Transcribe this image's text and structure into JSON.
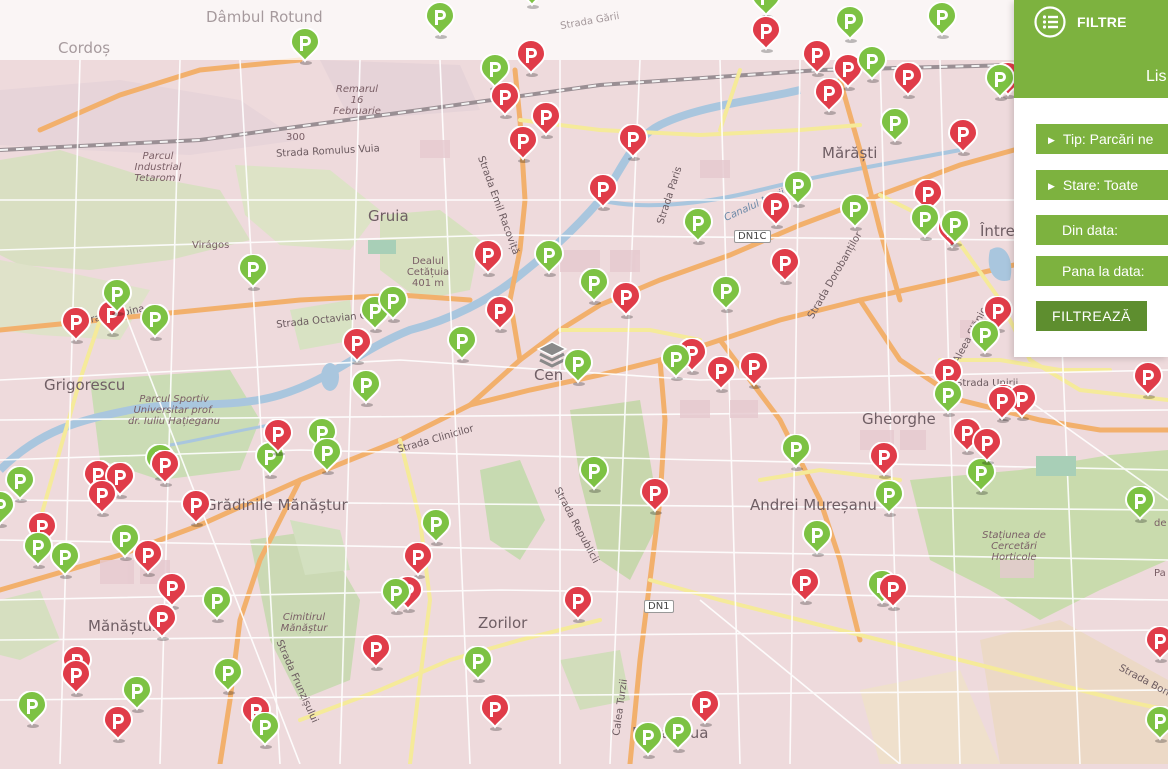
{
  "panel": {
    "title": "FILTRE",
    "list_title": "Lis",
    "type_filter": "Tip: Parcări ne",
    "status_filter": "Stare: Toate",
    "from_date": "Din data:",
    "to_date": "Pana la data:",
    "submit": "FILTREAZĂ"
  },
  "colors": {
    "green_pin": "#7dc243",
    "red_pin": "#e03c49",
    "panel": "#7db23f",
    "panel_button": "#5e8e2f"
  },
  "map_labels": {
    "districts": [
      "Grigorescu",
      "Grădinile Mănăștur",
      "Mănăștur",
      "Zorilor",
      "Andrei Mureșanu",
      "Gheorghe",
      "Mărăști",
      "Gruia",
      "Între",
      "Bună Ziua",
      "Cen",
      "Dâmbul Rotund",
      "Cordoș"
    ],
    "pois": [
      "Parcul Industrial Tetarom I",
      "Virágos",
      "Dealul Cetățuia 401 m",
      "Parcul Sportiv Universitar prof. dr. Iuliu Hațieganu",
      "Cimitirul Mănăștur",
      "Stațiunea de Cercetări Horticole",
      "Remarul 16 Februarie",
      "300",
      "Pa",
      "de"
    ],
    "streets": [
      "Strada Romulus Vuia",
      "Strada Emil Racoviță",
      "Strada Octavian Goga",
      "Strada Clinicilor",
      "Strada Republicii",
      "Strada Dorobanților",
      "Strada Paris",
      "Canalul Morii",
      "Strada Unirii",
      "Aleea Slănic",
      "Strada Borh",
      "Strada Frunzișului",
      "Calea Turzii",
      "Strada Gării",
      "Strada Doina"
    ],
    "roads": [
      "DN1C",
      "DN1"
    ]
  },
  "icons": {
    "pin": "parking-pin-icon",
    "menu": "list-menu-icon",
    "caret": "caret-right-icon",
    "center": "layers-icon"
  },
  "pins": [
    {
      "status": "green"
    },
    {
      "status": "red"
    },
    {
      "status": "green"
    },
    {
      "status": "red"
    },
    {
      "status": "red"
    },
    {
      "status": "red"
    },
    {
      "status": "red"
    },
    {
      "status": "red"
    },
    {
      "status": "green"
    },
    {
      "status": "green"
    },
    {
      "status": "red"
    },
    {
      "status": "green"
    },
    {
      "status": "red"
    },
    {
      "status": "red"
    },
    {
      "status": "green"
    },
    {
      "status": "red"
    },
    {
      "status": "red"
    },
    {
      "status": "green"
    },
    {
      "status": "red"
    },
    {
      "status": "green"
    },
    {
      "status": "red"
    },
    {
      "status": "green"
    },
    {
      "status": "green"
    },
    {
      "status": "red"
    },
    {
      "status": "green"
    },
    {
      "status": "red"
    },
    {
      "status": "green"
    },
    {
      "status": "red"
    },
    {
      "status": "green"
    },
    {
      "status": "green"
    },
    {
      "status": "green"
    },
    {
      "status": "red"
    },
    {
      "status": "green"
    },
    {
      "status": "red"
    },
    {
      "status": "green"
    },
    {
      "status": "red"
    },
    {
      "status": "green"
    },
    {
      "status": "green"
    },
    {
      "status": "red"
    },
    {
      "status": "green"
    },
    {
      "status": "red"
    },
    {
      "status": "green"
    },
    {
      "status": "red"
    },
    {
      "status": "red"
    },
    {
      "status": "green"
    },
    {
      "status": "red"
    },
    {
      "status": "red"
    },
    {
      "status": "green"
    },
    {
      "status": "red"
    },
    {
      "status": "green"
    },
    {
      "status": "green"
    },
    {
      "status": "red"
    },
    {
      "status": "red"
    },
    {
      "status": "green"
    },
    {
      "status": "red"
    },
    {
      "status": "red"
    },
    {
      "status": "green"
    },
    {
      "status": "green"
    },
    {
      "status": "red"
    },
    {
      "status": "green"
    },
    {
      "status": "green"
    },
    {
      "status": "red"
    },
    {
      "status": "green"
    },
    {
      "status": "red"
    },
    {
      "status": "red"
    },
    {
      "status": "red"
    },
    {
      "status": "green"
    },
    {
      "status": "red"
    },
    {
      "status": "green"
    },
    {
      "status": "red"
    },
    {
      "status": "green"
    },
    {
      "status": "red"
    },
    {
      "status": "green"
    },
    {
      "status": "red"
    },
    {
      "status": "green"
    },
    {
      "status": "red"
    },
    {
      "status": "red"
    },
    {
      "status": "red"
    },
    {
      "status": "green"
    },
    {
      "status": "green"
    },
    {
      "status": "red"
    },
    {
      "status": "green"
    },
    {
      "status": "green"
    },
    {
      "status": "red"
    },
    {
      "status": "red"
    },
    {
      "status": "green"
    },
    {
      "status": "green"
    },
    {
      "status": "red"
    },
    {
      "status": "red"
    },
    {
      "status": "green"
    },
    {
      "status": "red"
    },
    {
      "status": "green"
    },
    {
      "status": "red"
    },
    {
      "status": "green"
    },
    {
      "status": "red"
    },
    {
      "status": "green"
    },
    {
      "status": "red"
    },
    {
      "status": "red"
    },
    {
      "status": "green"
    },
    {
      "status": "green"
    },
    {
      "status": "red"
    },
    {
      "status": "red"
    },
    {
      "status": "green"
    },
    {
      "status": "red"
    },
    {
      "status": "green"
    },
    {
      "status": "green"
    },
    {
      "status": "red"
    },
    {
      "status": "green"
    },
    {
      "status": "red"
    },
    {
      "status": "green"
    },
    {
      "status": "red"
    },
    {
      "status": "green"
    },
    {
      "status": "green"
    },
    {
      "status": "green"
    },
    {
      "status": "red"
    },
    {
      "status": "green"
    },
    {
      "status": "red"
    },
    {
      "status": "green"
    },
    {
      "status": "green"
    },
    {
      "status": "red"
    }
  ]
}
